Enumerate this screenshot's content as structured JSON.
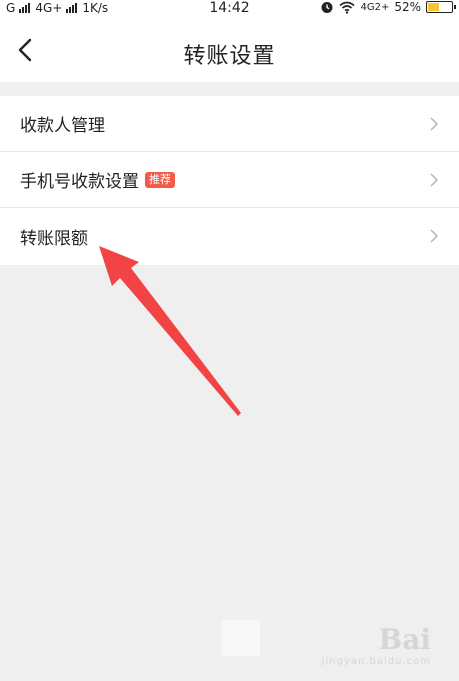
{
  "status": {
    "carrier1": "G",
    "carrier2": "4G+",
    "speed": "1K/s",
    "time": "14:42",
    "network": "4G2+",
    "battery": "52%",
    "battery_level": 0.52
  },
  "nav": {
    "title": "转账设置"
  },
  "list": {
    "items": [
      {
        "label": "收款人管理"
      },
      {
        "label": "手机号收款设置",
        "badge": "推荐"
      },
      {
        "label": "转账限额"
      }
    ]
  },
  "watermark": {
    "brand": "Bai",
    "sub": "jingyan.baidu.com"
  },
  "colors": {
    "accent_badge": "#f25a4a",
    "arrow": "#f24444",
    "background": "#efefef"
  }
}
